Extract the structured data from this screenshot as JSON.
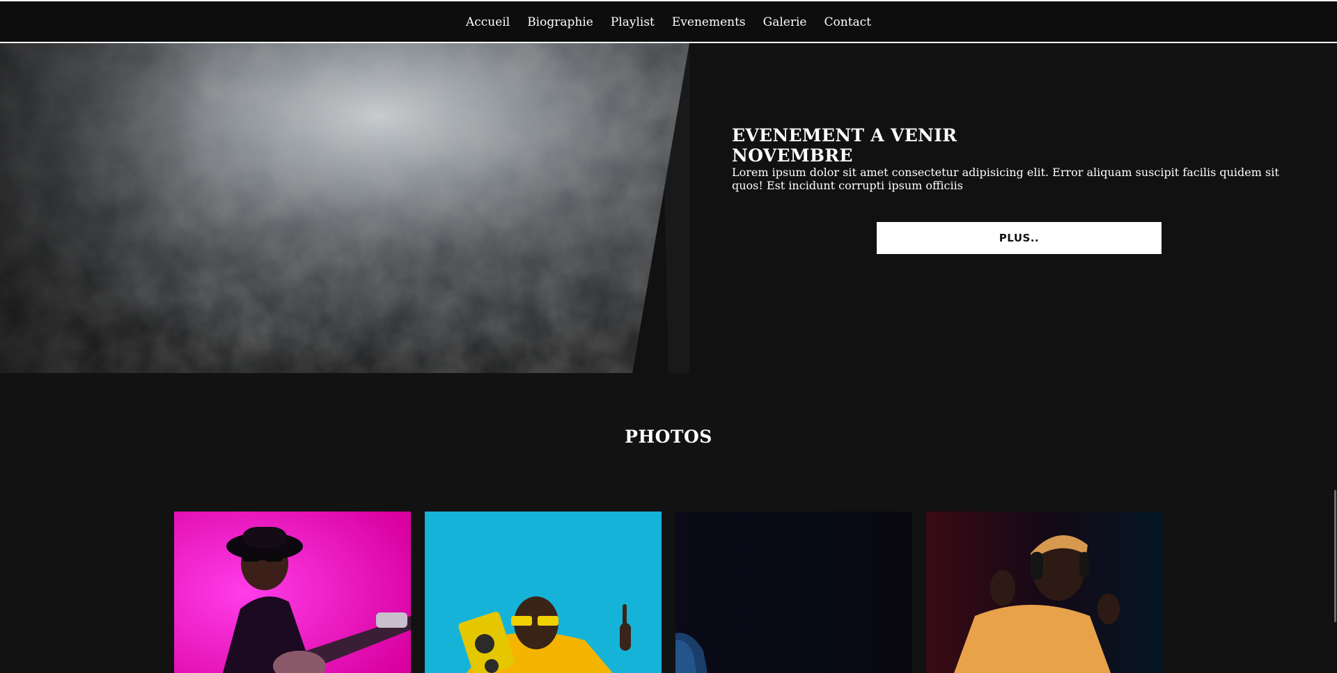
{
  "nav": {
    "items": [
      {
        "label": "Accueil"
      },
      {
        "label": "Biographie"
      },
      {
        "label": "Playlist"
      },
      {
        "label": "Evenements"
      },
      {
        "label": "Galerie"
      },
      {
        "label": "Contact"
      }
    ]
  },
  "event": {
    "title_line1": "EVENEMENT A VENIR",
    "title_line2": "NOVEMBRE",
    "description": "Lorem ipsum dolor sit amet consectetur adipisicing elit. Error aliquam suscipit facilis quidem sit quos! Est incidunt corrupti ipsum officiis",
    "button_label": "PLUS.."
  },
  "photos": {
    "title": "PHOTOS"
  },
  "colors": {
    "background": "#121212",
    "nav_background": "#0d0d0d",
    "text": "#ffffff",
    "button_bg": "#ffffff",
    "photo1_bg": "#e819c8",
    "photo2_bg": "#19b0d8",
    "photo3_bg": "#07060f",
    "photo4_bg": "#1b0a12"
  }
}
